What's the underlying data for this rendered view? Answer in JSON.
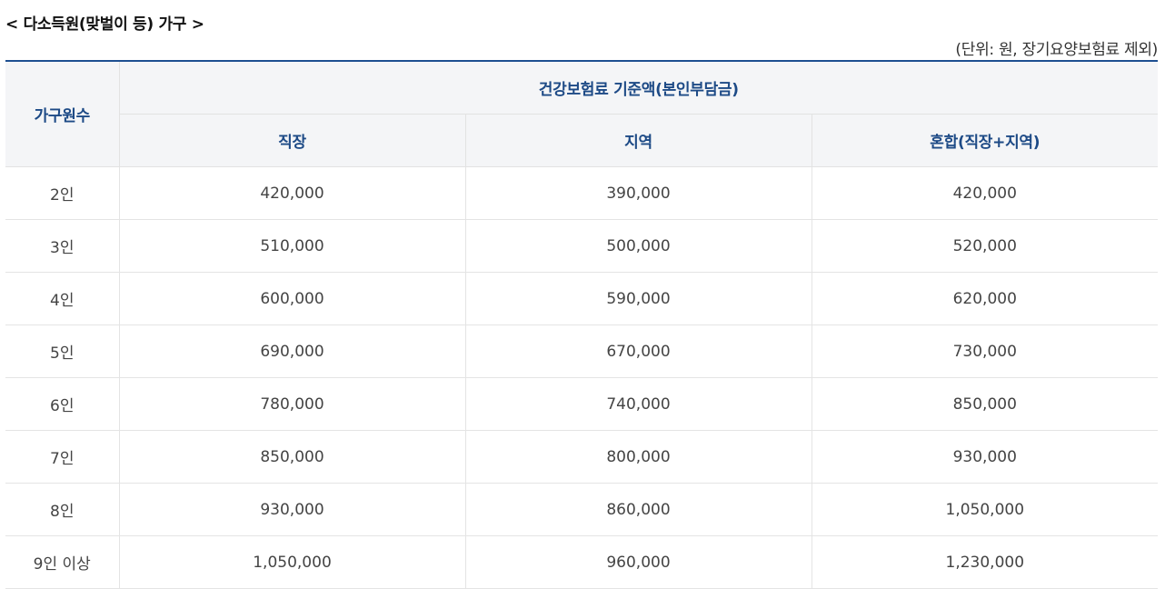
{
  "section_title": "< 다소득원(맞벌이 등) 가구 >",
  "unit_note": "(단위: 원, 장기요양보험료 제외)",
  "table": {
    "header_household": "가구원수",
    "header_group": "건강보험료 기준액(본인부담금)",
    "columns": [
      "직장",
      "지역",
      "혼합(직장+지역)"
    ],
    "rows": [
      {
        "label": "2인",
        "values": [
          "420,000",
          "390,000",
          "420,000"
        ]
      },
      {
        "label": "3인",
        "values": [
          "510,000",
          "500,000",
          "520,000"
        ]
      },
      {
        "label": "4인",
        "values": [
          "600,000",
          "590,000",
          "620,000"
        ]
      },
      {
        "label": "5인",
        "values": [
          "690,000",
          "670,000",
          "730,000"
        ]
      },
      {
        "label": "6인",
        "values": [
          "780,000",
          "740,000",
          "850,000"
        ]
      },
      {
        "label": "7인",
        "values": [
          "850,000",
          "800,000",
          "930,000"
        ]
      },
      {
        "label": "8인",
        "values": [
          "930,000",
          "860,000",
          "1,050,000"
        ]
      },
      {
        "label": "9인 이상",
        "values": [
          "1,050,000",
          "960,000",
          "1,230,000"
        ]
      }
    ]
  }
}
